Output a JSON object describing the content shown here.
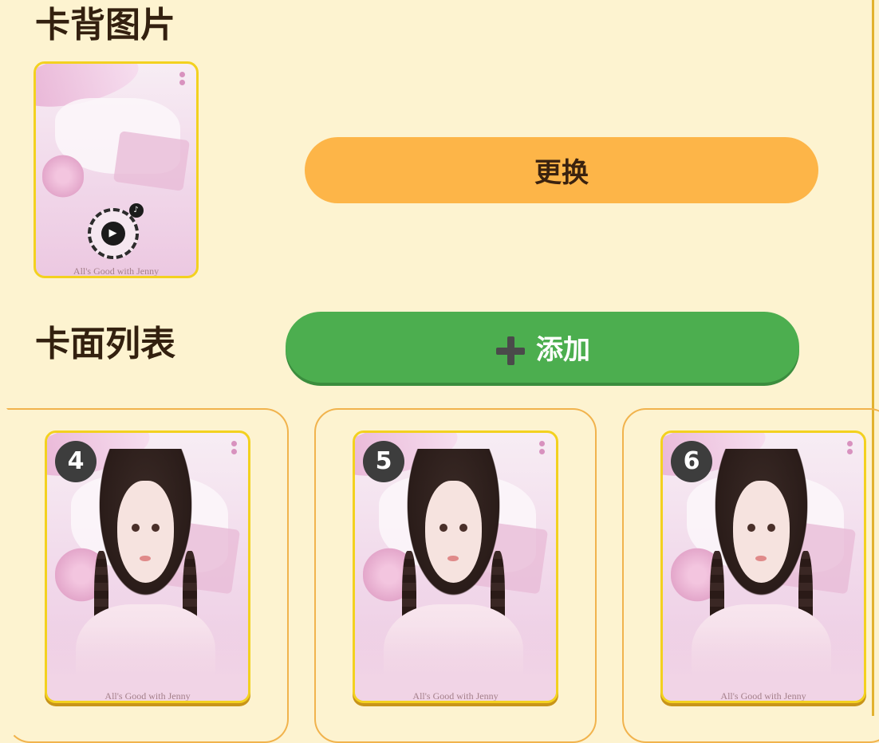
{
  "card_back": {
    "title": "卡背图片",
    "caption": "All's Good with Jenny",
    "change_label": "更换"
  },
  "card_list": {
    "title": "卡面列表",
    "add_label": "添加",
    "items": [
      {
        "number": "4",
        "caption": "All's Good with Jenny"
      },
      {
        "number": "5",
        "caption": "All's Good with Jenny"
      },
      {
        "number": "6",
        "caption": "All's Good with Jenny"
      }
    ]
  },
  "colors": {
    "background": "#fdf3d0",
    "change_button": "#fdb548",
    "add_button": "#4cae4f",
    "tile_border": "#f1b34d",
    "card_border": "#f3d11f"
  },
  "icons": {
    "add": "plus-icon",
    "qr_play": "play-icon",
    "qr_brand": "tiktok-icon"
  }
}
